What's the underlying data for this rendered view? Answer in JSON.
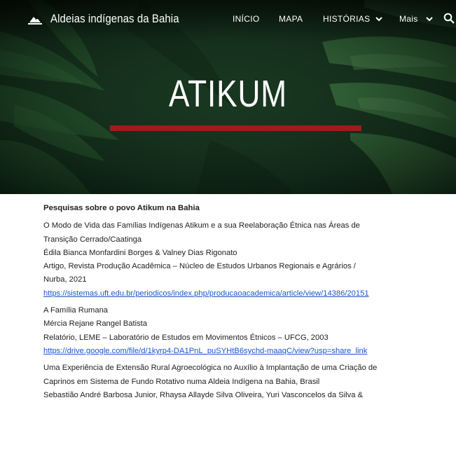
{
  "header": {
    "site_title": "Aldeias indígenas da Bahia",
    "nav": {
      "inicio": "INÍCIO",
      "mapa": "MAPA",
      "historias": "HISTÓRIAS",
      "mais": "Mais"
    },
    "icons": {
      "logo": "landscape-logo-icon",
      "chevron": "chevron-down-icon",
      "search": "search-icon"
    }
  },
  "hero": {
    "title": "ATIKUM",
    "accent_color": "#9e1c1c"
  },
  "content": {
    "heading": "Pesquisas sobre o povo Atikum na Bahia",
    "entries": [
      {
        "lines": [
          "O Modo de Vida das Famílias Indígenas Atikum e a sua Reelaboração Étnica nas Áreas de",
          "Transição Cerrado/Caatinga",
          "Édila Bianca Monfardini Borges & Valney Dias Rigonato",
          "Artigo, Revista Produção Acadêmica – Núcleo de Estudos Urbanos Regionais e Agrários /",
          "Nurba, 2021"
        ],
        "link": "https://sistemas.uft.edu.br/periodicos/index.php/producaoacademica/article/view/14386/20151"
      },
      {
        "lines": [
          "A Família Rumana",
          "Mércia Rejane Rangel Batista",
          "Relatório, LEME – Laboratório de Estudos em Movimentos Étnicos – UFCG, 2003"
        ],
        "link": "https://drive.google.com/file/d/1kyrp4-DA1PnL_puSYHtB6sychd-maaqC/view?usp=share_link"
      },
      {
        "lines": [
          "Uma Experiência de Extensão Rural Agroecológica no Auxílio à Implantação de uma Criação de",
          "Caprinos em Sistema de Fundo Rotativo numa Aldeia Indígena na Bahia, Brasil",
          "Sebastião André Barbosa Junior, Rhaysa Allayde Silva Oliveira, Yuri Vasconcelos da Silva &"
        ],
        "link": ""
      }
    ]
  }
}
